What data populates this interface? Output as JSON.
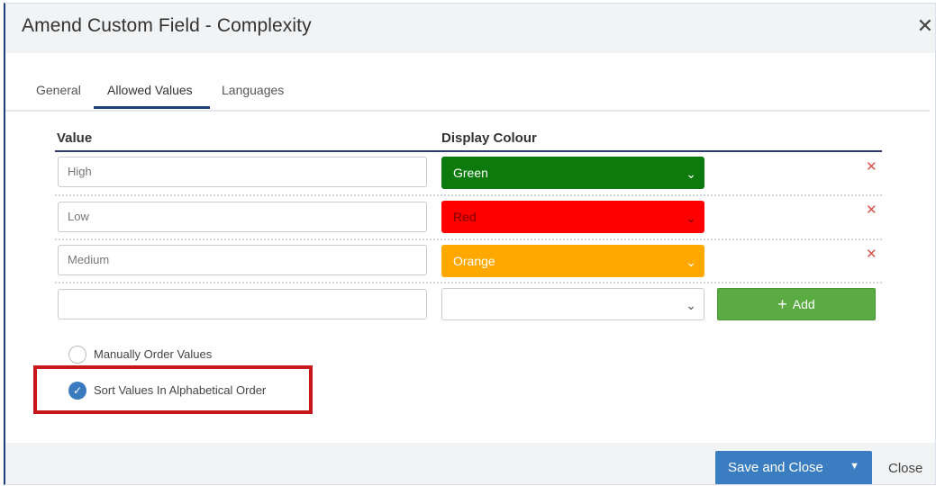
{
  "dialog": {
    "title": "Amend Custom Field - Complexity",
    "close_icon": "close-icon"
  },
  "tabs": [
    {
      "label": "General",
      "active": false
    },
    {
      "label": "Allowed Values",
      "active": true
    },
    {
      "label": "Languages",
      "active": false
    }
  ],
  "table": {
    "headers": {
      "value": "Value",
      "display_colour": "Display Colour"
    },
    "rows": [
      {
        "value": "High",
        "colour_label": "Green",
        "colour_hex": "#0c7a0c",
        "text_color": "#ffffff"
      },
      {
        "value": "Low",
        "colour_label": "Red",
        "colour_hex": "#fe0000",
        "text_color": "#7a0000"
      },
      {
        "value": "Medium",
        "colour_label": "Orange",
        "colour_hex": "#fea800",
        "text_color": "#ffffff"
      }
    ],
    "new_row": {
      "value": "",
      "colour_label": ""
    },
    "add_label": "Add",
    "remove_icon": "remove-icon"
  },
  "ordering": {
    "options": [
      {
        "label": "Manually Order Values",
        "selected": false
      },
      {
        "label": "Sort Values In Alphabetical Order",
        "selected": true
      }
    ]
  },
  "footer": {
    "save_label": "Save and Close",
    "close_label": "Close"
  },
  "colors": {
    "accent": "#3b7dc1",
    "add_green": "#5aab42",
    "remove_red": "#d9534f",
    "highlight": "#c8161d"
  }
}
